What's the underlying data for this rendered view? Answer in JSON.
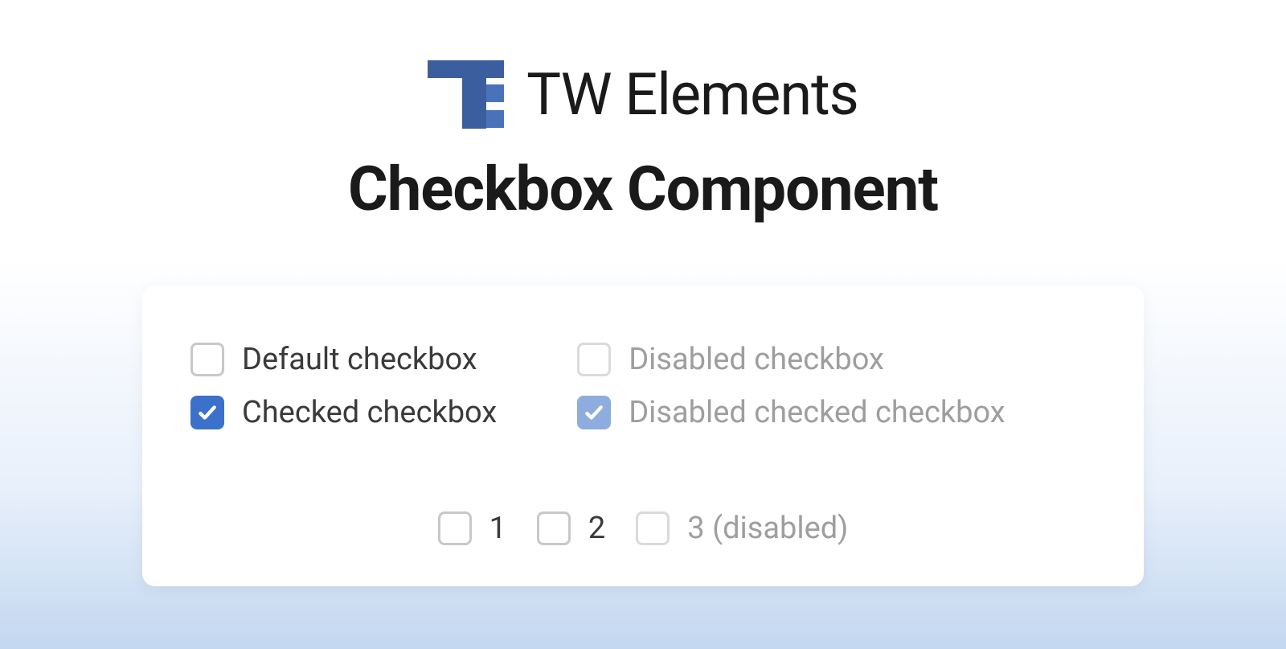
{
  "brand": {
    "name": "TW Elements"
  },
  "subtitle": "Checkbox Component",
  "checkboxes": {
    "default_label": "Default checkbox",
    "checked_label": "Checked checkbox",
    "disabled_label": "Disabled checkbox",
    "disabled_checked_label": "Disabled checked checkbox"
  },
  "inline": {
    "option1": "1",
    "option2": "2",
    "option3": "3 (disabled)"
  },
  "colors": {
    "primary": "#3b71ca",
    "primary_disabled": "#8eadde",
    "text": "#3a3a3a",
    "text_disabled": "#9e9e9e",
    "border": "#c8c8c8"
  }
}
